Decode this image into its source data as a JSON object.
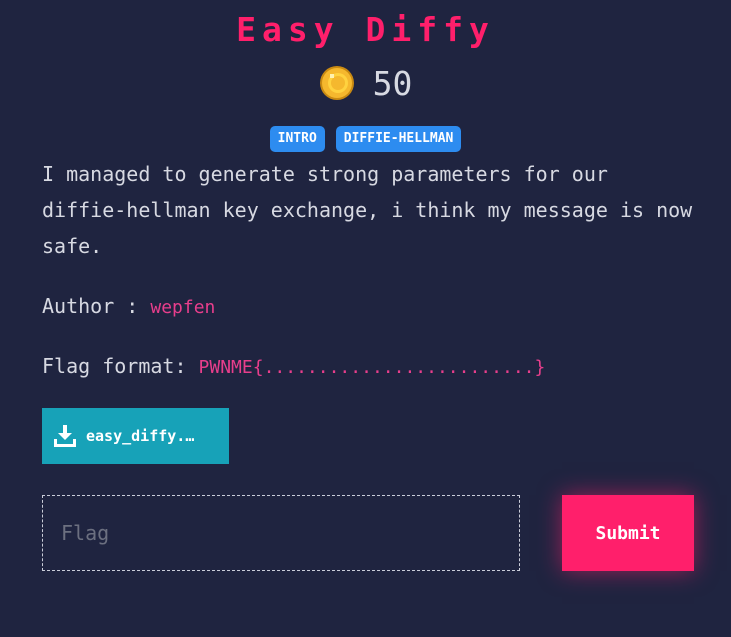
{
  "challenge": {
    "title": "Easy Diffy",
    "points": "50",
    "tags": [
      "INTRO",
      "DIFFIE-HELLMAN"
    ],
    "description": "I managed to generate strong parameters for our diffie-hellman key exchange, i think my message is now safe.",
    "author_label": "Author : ",
    "author_name": "wepfen",
    "flag_format_label": "Flag format: ",
    "flag_format_value": "PWNME{.........................}"
  },
  "download": {
    "icon": "download-icon",
    "label": "easy_diffy.…"
  },
  "form": {
    "flag_placeholder": "Flag",
    "flag_value": "",
    "submit_label": "Submit"
  },
  "colors": {
    "background": "#1f2440",
    "accent": "#ff1f6b",
    "tag": "#2d8cf0",
    "download": "#17a2b8",
    "highlight": "#e83e8c",
    "coin": "#f5b82e"
  }
}
